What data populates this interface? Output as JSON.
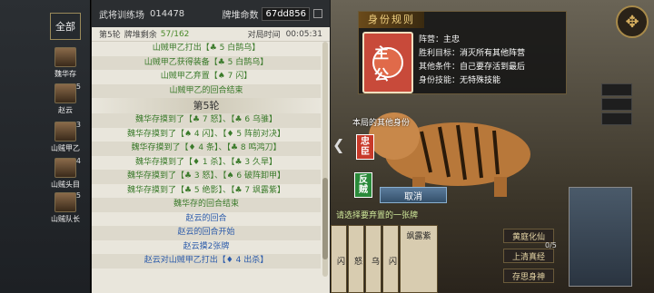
{
  "sidebar": {
    "all_label": "全部",
    "players": [
      {
        "name": "魏华存",
        "hp": ""
      },
      {
        "name": "赵云",
        "hp": "5"
      },
      {
        "name": "山贼甲乙",
        "hp": "3"
      },
      {
        "name": "山贼头目",
        "hp": "4"
      },
      {
        "name": "山贼队长",
        "hp": "5"
      }
    ]
  },
  "log": {
    "room": "武将训练场",
    "room_id": "014478",
    "deck_label": "牌堆命数",
    "deck_id": "67dd856",
    "round_label": "第5轮",
    "remaining_label": "牌堆剩余",
    "remaining": "57/162",
    "time_label": "对局时间",
    "time": "00:05:31",
    "lines": [
      {
        "text": "山贼甲乙打出【♣ 5 白鹄乌】",
        "color": "green"
      },
      {
        "text": "山贼甲乙获得装备【♣ 5 白鹄乌】",
        "color": "green"
      },
      {
        "text": "山贼甲乙弃置【♠ 7 闪】",
        "color": "green"
      },
      {
        "text": "山贼甲乙的回合结束",
        "color": "green"
      },
      {
        "text": "第5轮",
        "color": "title"
      },
      {
        "text": "魏华存摸到了【♣ 7 怒】、【♣ 6 乌骓】",
        "color": "green"
      },
      {
        "text": "魏华存摸到了【♠ 4 闪】、【♦ 5 阵前对决】",
        "color": "green"
      },
      {
        "text": "魏华存摸到了【♦ 4 条】、【♣ 8 鸣鸿刀】",
        "color": "green"
      },
      {
        "text": "魏华存摸到了【♦ 1 杀】、【♣ 3 久旱】",
        "color": "green"
      },
      {
        "text": "魏华存摸到了【♣ 3 怒】、【♠ 6 破阵卸甲】",
        "color": "green"
      },
      {
        "text": "魏华存摸到了【♣ 5 绝影】、【♣ 7 飒露紫】",
        "color": "green"
      },
      {
        "text": "魏华存的回合结束",
        "color": "green"
      },
      {
        "text": "赵云的回合",
        "color": "blue"
      },
      {
        "text": "赵云的回合开始",
        "color": "blue"
      },
      {
        "text": "赵云摸2张牌",
        "color": "blue"
      },
      {
        "text": "赵云对山贼甲乙打出【♦ 4 出杀】",
        "color": "blue"
      }
    ]
  },
  "scene": {
    "dialog_title": "身份规则",
    "card_text": "主公",
    "info": [
      {
        "k": "阵营：",
        "v": "主忠"
      },
      {
        "k": "胜利目标：",
        "v": "消灭所有其他阵营"
      },
      {
        "k": "其他条件：",
        "v": "自己要存活到最后"
      },
      {
        "k": "身份技能：",
        "v": "无特殊技能"
      }
    ],
    "others_label": "本局的其他身份",
    "card_zhong": "忠臣",
    "card_fan": "反贼",
    "cancel": "取消",
    "status": "请选择要弃置的一张牌",
    "buttons": {
      "a": "黄庭化仙",
      "b": "上清真经",
      "c": "存思身神"
    },
    "count": "0/5",
    "hand": [
      "闪",
      "怒",
      "乌",
      "闪",
      "飒露紫"
    ],
    "menu_icon": "✥",
    "side": [
      "",
      "",
      "",
      "",
      ""
    ]
  }
}
